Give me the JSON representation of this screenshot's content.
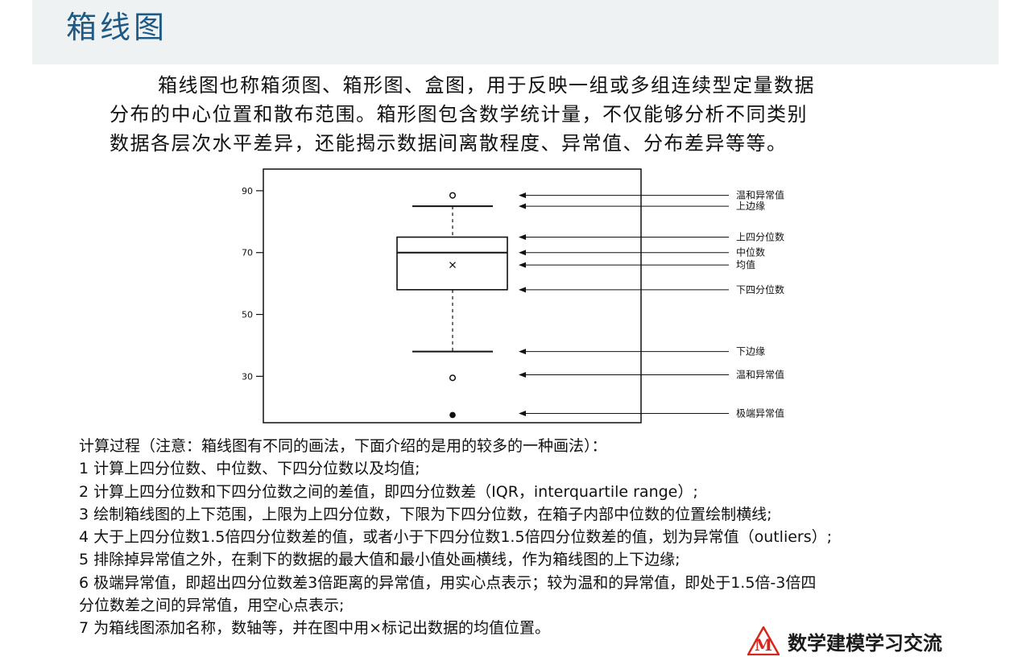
{
  "title": "箱线图",
  "intro": {
    "line1": "箱线图也称箱须图、箱形图、盒图，用于反映一组或多组连续型定量数据",
    "line2": "分布的中心位置和散布范围。箱形图包含数学统计量，不仅能够分析不同类别",
    "line3": "数据各层次水平差异，还能揭示数据间离散程度、异常值、分布差异等等。"
  },
  "chart_data": {
    "type": "boxplot",
    "title": "",
    "xlabel": "",
    "ylabel": "",
    "ylim": [
      15,
      97
    ],
    "yticks": [
      30,
      50,
      70,
      90
    ],
    "ytick_labels": [
      "30",
      "50",
      "70",
      "90"
    ],
    "box": {
      "upper_whisker": 85,
      "q3": 75,
      "median": 70,
      "mean": 66,
      "q1": 58,
      "lower_whisker": 38
    },
    "mild_outliers": [
      88.5,
      29.5
    ],
    "extreme_outliers": [
      17.5
    ],
    "annotations": [
      {
        "label": "温和异常值",
        "value": 88.5
      },
      {
        "label": "上边缘",
        "value": 85
      },
      {
        "label": "上四分位数",
        "value": 75
      },
      {
        "label": "中位数",
        "value": 70
      },
      {
        "label": "均值",
        "value": 66
      },
      {
        "label": "下四分位数",
        "value": 58
      },
      {
        "label": "下边缘",
        "value": 38
      },
      {
        "label": "温和异常值",
        "value": 30.5
      },
      {
        "label": "极端异常值",
        "value": 18
      }
    ]
  },
  "steps": {
    "heading": "计算过程（注意：箱线图有不同的画法，下面介绍的是用的较多的一种画法）：",
    "items": [
      "1 计算上四分位数、中位数、下四分位数以及均值;",
      "2 计算上四分位数和下四分位数之间的差值，即四分位数差（IQR，interquartile range）;",
      "3 绘制箱线图的上下范围，上限为上四分位数，下限为下四分位数，在箱子内部中位数的位置绘制横线;",
      "4 大于上四分位数1.5倍四分位数差的值，或者小于下四分位数1.5倍四分位数差的值，划为异常值（outliers）;",
      "5 排除掉异常值之外，在剩下的数据的最大值和最小值处画横线，作为箱线图的上下边缘;",
      "6 极端异常值，即超出四分位数差3倍距离的异常值，用实心点表示；较为温和的异常值，即处于1.5倍-3倍四",
      "分位数差之间的异常值，用空心点表示;",
      "7 为箱线图添加名称，数轴等，并在图中用×标记出数据的均值位置。"
    ]
  },
  "logo": {
    "mark_letter": "M",
    "text": "数学建模学习交流"
  },
  "colors": {
    "title": "#1f5a84",
    "header_band": "#eef2f2",
    "logo_red": "#d9261c"
  }
}
